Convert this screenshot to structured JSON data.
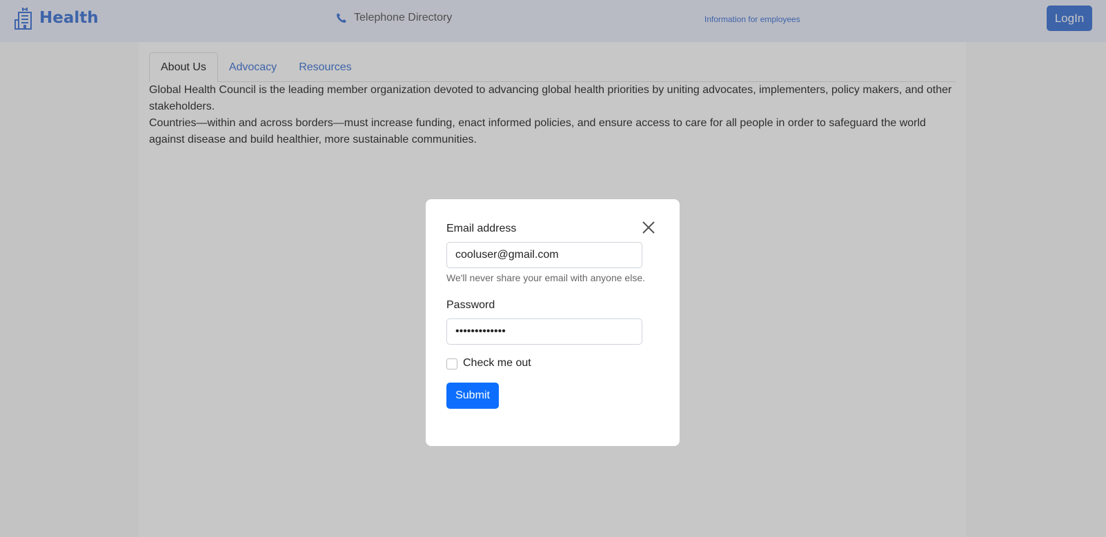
{
  "header": {
    "brand": "Health",
    "brand_icon": "hospital-building-icon",
    "phone_icon": "phone-icon",
    "phone_link": "Telephone Directory",
    "info_link": "Information for employees",
    "login": "LogIn"
  },
  "tabs": [
    {
      "label": "About Us",
      "active": true
    },
    {
      "label": "Advocacy",
      "active": false
    },
    {
      "label": "Resources",
      "active": false
    }
  ],
  "about": {
    "p1": "Global Health Council is the leading member organization devoted to advancing global health priorities by uniting advocates, implementers, policy makers, and other stakeholders.",
    "p2": "Countries—within and across borders—must increase funding, enact informed policies, and ensure access to care for all people in order to safeguard the world against disease and build healthier, more sustainable communities."
  },
  "modal": {
    "email_label": "Email address",
    "email_value": "cooluser@gmail.com",
    "email_hint": "We'll never share your email with anyone else.",
    "password_label": "Password",
    "password_value": "•••••••••••••",
    "checkbox_label": "Check me out",
    "checkbox_checked": false,
    "submit": "Submit",
    "close_icon": "close-icon"
  },
  "colors": {
    "accent": "#4f7fd9",
    "primary_button": "#0d6efd"
  }
}
